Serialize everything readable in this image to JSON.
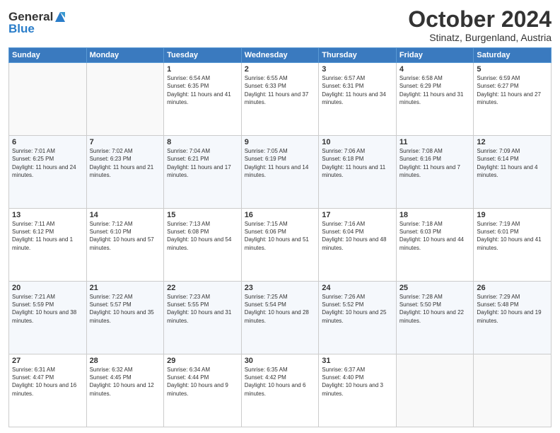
{
  "header": {
    "logo_general": "General",
    "logo_blue": "Blue",
    "month_title": "October 2024",
    "location": "Stinatz, Burgenland, Austria"
  },
  "days_of_week": [
    "Sunday",
    "Monday",
    "Tuesday",
    "Wednesday",
    "Thursday",
    "Friday",
    "Saturday"
  ],
  "weeks": [
    [
      {
        "day": "",
        "sunrise": "",
        "sunset": "",
        "daylight": "",
        "empty": true
      },
      {
        "day": "",
        "sunrise": "",
        "sunset": "",
        "daylight": "",
        "empty": true
      },
      {
        "day": "1",
        "sunrise": "Sunrise: 6:54 AM",
        "sunset": "Sunset: 6:35 PM",
        "daylight": "Daylight: 11 hours and 41 minutes."
      },
      {
        "day": "2",
        "sunrise": "Sunrise: 6:55 AM",
        "sunset": "Sunset: 6:33 PM",
        "daylight": "Daylight: 11 hours and 37 minutes."
      },
      {
        "day": "3",
        "sunrise": "Sunrise: 6:57 AM",
        "sunset": "Sunset: 6:31 PM",
        "daylight": "Daylight: 11 hours and 34 minutes."
      },
      {
        "day": "4",
        "sunrise": "Sunrise: 6:58 AM",
        "sunset": "Sunset: 6:29 PM",
        "daylight": "Daylight: 11 hours and 31 minutes."
      },
      {
        "day": "5",
        "sunrise": "Sunrise: 6:59 AM",
        "sunset": "Sunset: 6:27 PM",
        "daylight": "Daylight: 11 hours and 27 minutes."
      }
    ],
    [
      {
        "day": "6",
        "sunrise": "Sunrise: 7:01 AM",
        "sunset": "Sunset: 6:25 PM",
        "daylight": "Daylight: 11 hours and 24 minutes."
      },
      {
        "day": "7",
        "sunrise": "Sunrise: 7:02 AM",
        "sunset": "Sunset: 6:23 PM",
        "daylight": "Daylight: 11 hours and 21 minutes."
      },
      {
        "day": "8",
        "sunrise": "Sunrise: 7:04 AM",
        "sunset": "Sunset: 6:21 PM",
        "daylight": "Daylight: 11 hours and 17 minutes."
      },
      {
        "day": "9",
        "sunrise": "Sunrise: 7:05 AM",
        "sunset": "Sunset: 6:19 PM",
        "daylight": "Daylight: 11 hours and 14 minutes."
      },
      {
        "day": "10",
        "sunrise": "Sunrise: 7:06 AM",
        "sunset": "Sunset: 6:18 PM",
        "daylight": "Daylight: 11 hours and 11 minutes."
      },
      {
        "day": "11",
        "sunrise": "Sunrise: 7:08 AM",
        "sunset": "Sunset: 6:16 PM",
        "daylight": "Daylight: 11 hours and 7 minutes."
      },
      {
        "day": "12",
        "sunrise": "Sunrise: 7:09 AM",
        "sunset": "Sunset: 6:14 PM",
        "daylight": "Daylight: 11 hours and 4 minutes."
      }
    ],
    [
      {
        "day": "13",
        "sunrise": "Sunrise: 7:11 AM",
        "sunset": "Sunset: 6:12 PM",
        "daylight": "Daylight: 11 hours and 1 minute."
      },
      {
        "day": "14",
        "sunrise": "Sunrise: 7:12 AM",
        "sunset": "Sunset: 6:10 PM",
        "daylight": "Daylight: 10 hours and 57 minutes."
      },
      {
        "day": "15",
        "sunrise": "Sunrise: 7:13 AM",
        "sunset": "Sunset: 6:08 PM",
        "daylight": "Daylight: 10 hours and 54 minutes."
      },
      {
        "day": "16",
        "sunrise": "Sunrise: 7:15 AM",
        "sunset": "Sunset: 6:06 PM",
        "daylight": "Daylight: 10 hours and 51 minutes."
      },
      {
        "day": "17",
        "sunrise": "Sunrise: 7:16 AM",
        "sunset": "Sunset: 6:04 PM",
        "daylight": "Daylight: 10 hours and 48 minutes."
      },
      {
        "day": "18",
        "sunrise": "Sunrise: 7:18 AM",
        "sunset": "Sunset: 6:03 PM",
        "daylight": "Daylight: 10 hours and 44 minutes."
      },
      {
        "day": "19",
        "sunrise": "Sunrise: 7:19 AM",
        "sunset": "Sunset: 6:01 PM",
        "daylight": "Daylight: 10 hours and 41 minutes."
      }
    ],
    [
      {
        "day": "20",
        "sunrise": "Sunrise: 7:21 AM",
        "sunset": "Sunset: 5:59 PM",
        "daylight": "Daylight: 10 hours and 38 minutes."
      },
      {
        "day": "21",
        "sunrise": "Sunrise: 7:22 AM",
        "sunset": "Sunset: 5:57 PM",
        "daylight": "Daylight: 10 hours and 35 minutes."
      },
      {
        "day": "22",
        "sunrise": "Sunrise: 7:23 AM",
        "sunset": "Sunset: 5:55 PM",
        "daylight": "Daylight: 10 hours and 31 minutes."
      },
      {
        "day": "23",
        "sunrise": "Sunrise: 7:25 AM",
        "sunset": "Sunset: 5:54 PM",
        "daylight": "Daylight: 10 hours and 28 minutes."
      },
      {
        "day": "24",
        "sunrise": "Sunrise: 7:26 AM",
        "sunset": "Sunset: 5:52 PM",
        "daylight": "Daylight: 10 hours and 25 minutes."
      },
      {
        "day": "25",
        "sunrise": "Sunrise: 7:28 AM",
        "sunset": "Sunset: 5:50 PM",
        "daylight": "Daylight: 10 hours and 22 minutes."
      },
      {
        "day": "26",
        "sunrise": "Sunrise: 7:29 AM",
        "sunset": "Sunset: 5:48 PM",
        "daylight": "Daylight: 10 hours and 19 minutes."
      }
    ],
    [
      {
        "day": "27",
        "sunrise": "Sunrise: 6:31 AM",
        "sunset": "Sunset: 4:47 PM",
        "daylight": "Daylight: 10 hours and 16 minutes."
      },
      {
        "day": "28",
        "sunrise": "Sunrise: 6:32 AM",
        "sunset": "Sunset: 4:45 PM",
        "daylight": "Daylight: 10 hours and 12 minutes."
      },
      {
        "day": "29",
        "sunrise": "Sunrise: 6:34 AM",
        "sunset": "Sunset: 4:44 PM",
        "daylight": "Daylight: 10 hours and 9 minutes."
      },
      {
        "day": "30",
        "sunrise": "Sunrise: 6:35 AM",
        "sunset": "Sunset: 4:42 PM",
        "daylight": "Daylight: 10 hours and 6 minutes."
      },
      {
        "day": "31",
        "sunrise": "Sunrise: 6:37 AM",
        "sunset": "Sunset: 4:40 PM",
        "daylight": "Daylight: 10 hours and 3 minutes."
      },
      {
        "day": "",
        "sunrise": "",
        "sunset": "",
        "daylight": "",
        "empty": true
      },
      {
        "day": "",
        "sunrise": "",
        "sunset": "",
        "daylight": "",
        "empty": true
      }
    ]
  ]
}
